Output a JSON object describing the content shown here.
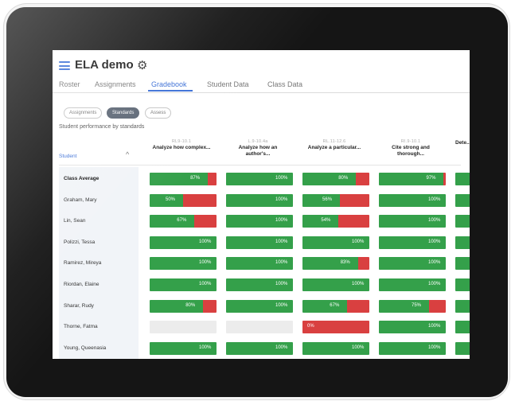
{
  "app": {
    "title": "ELA demo"
  },
  "tabs": [
    "Roster",
    "Assignments",
    "Gradebook",
    "Student Data",
    "Class Data"
  ],
  "active_tab": "Gradebook",
  "view_pills": [
    "Assignments",
    "Standards",
    "Assess"
  ],
  "active_pill": "Standards",
  "subtitle": "Student performance by standards",
  "student_header": "Student",
  "standards": [
    {
      "code": "RL9-10.1",
      "title": "Analyze how complex..."
    },
    {
      "code": "L.9-10.4a",
      "title": "Analyze how an author's..."
    },
    {
      "code": "RL.11-12.6",
      "title": "Analyze a particular..."
    },
    {
      "code": "RI.9-10.1",
      "title": "Cite strong and thorough..."
    },
    {
      "code": "",
      "title": "Dete..."
    }
  ],
  "rows": [
    {
      "name": "Class Average",
      "bold": true,
      "scores": [
        87,
        100,
        80,
        97,
        100
      ]
    },
    {
      "name": "Graham, Mary",
      "bold": false,
      "scores": [
        50,
        100,
        56,
        100,
        100
      ]
    },
    {
      "name": "Lin, Sean",
      "bold": false,
      "scores": [
        67,
        100,
        54,
        100,
        100
      ]
    },
    {
      "name": "Polizzi, Tessa",
      "bold": false,
      "scores": [
        100,
        100,
        100,
        100,
        100
      ]
    },
    {
      "name": "Ramirez, Mireya",
      "bold": false,
      "scores": [
        100,
        100,
        83,
        100,
        100
      ]
    },
    {
      "name": "Riordan, Elaine",
      "bold": false,
      "scores": [
        100,
        100,
        100,
        100,
        100
      ]
    },
    {
      "name": "Sharar, Rudy",
      "bold": false,
      "scores": [
        80,
        100,
        67,
        75,
        100
      ]
    },
    {
      "name": "Thorne, Fatma",
      "bold": false,
      "scores": [
        null,
        null,
        0,
        100,
        100
      ]
    },
    {
      "name": "Young, Queenasia",
      "bold": false,
      "scores": [
        100,
        100,
        100,
        100,
        100
      ]
    }
  ],
  "score_labels": [
    [
      "87%",
      "100%",
      "80%",
      "97%",
      ""
    ],
    [
      "50%",
      "100%",
      "56%",
      "100%",
      ""
    ],
    [
      "67%",
      "100%",
      "54%",
      "100%",
      ""
    ],
    [
      "100%",
      "100%",
      "100%",
      "100%",
      ""
    ],
    [
      "100%",
      "100%",
      "83%",
      "100%",
      ""
    ],
    [
      "100%",
      "100%",
      "100%",
      "100%",
      ""
    ],
    [
      "80%",
      "100%",
      "67%",
      "75%",
      ""
    ],
    [
      "",
      "",
      "0%",
      "100%",
      ""
    ],
    [
      "100%",
      "100%",
      "100%",
      "100%",
      ""
    ]
  ],
  "colors": {
    "accent": "#3b6fd6",
    "pass": "#34a04a",
    "fail": "#d94040",
    "empty": "#ececec"
  }
}
